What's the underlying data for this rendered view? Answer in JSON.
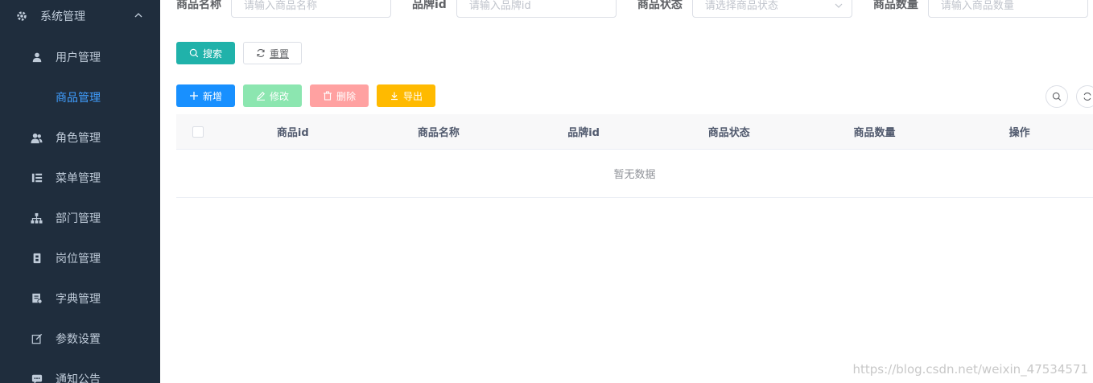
{
  "sidebar": {
    "parent": {
      "label": "系统管理",
      "icon": "gear-icon"
    },
    "items": [
      {
        "label": "用户管理",
        "icon": "user-icon",
        "active": false
      },
      {
        "label": "商品管理",
        "icon": "",
        "active": true
      },
      {
        "label": "角色管理",
        "icon": "peoples-icon",
        "active": false
      },
      {
        "label": "菜单管理",
        "icon": "tree-table-icon",
        "active": false
      },
      {
        "label": "部门管理",
        "icon": "tree-icon",
        "active": false
      },
      {
        "label": "岗位管理",
        "icon": "post-icon",
        "active": false
      },
      {
        "label": "字典管理",
        "icon": "dict-icon",
        "active": false
      },
      {
        "label": "参数设置",
        "icon": "edit-icon",
        "active": false
      },
      {
        "label": "通知公告",
        "icon": "message-icon",
        "active": false
      }
    ]
  },
  "search": {
    "fields": [
      {
        "label": "商品名称",
        "placeholder": "请输入商品名称"
      },
      {
        "label": "品牌id",
        "placeholder": "请输入品牌id"
      },
      {
        "label": "商品状态",
        "placeholder": "请选择商品状态"
      },
      {
        "label": "商品数量",
        "placeholder": "请输入商品数量"
      }
    ],
    "search_label": "搜索",
    "reset_label": "重置"
  },
  "toolbar": {
    "add_label": "新增",
    "edit_label": "修改",
    "delete_label": "删除",
    "export_label": "导出"
  },
  "table": {
    "columns": [
      "商品id",
      "商品名称",
      "品牌id",
      "商品状态",
      "商品数量",
      "操作"
    ],
    "empty_text": "暂无数据"
  },
  "watermark": "https://blog.csdn.net/weixin_47534571",
  "colors": {
    "sidebar_bg": "#1f2d3d",
    "active": "#409eff",
    "search": "#20b2aa",
    "primary": "#1890ff",
    "success": "#8ce6b0",
    "danger": "#ffa1a1",
    "warning": "#ffba00"
  }
}
